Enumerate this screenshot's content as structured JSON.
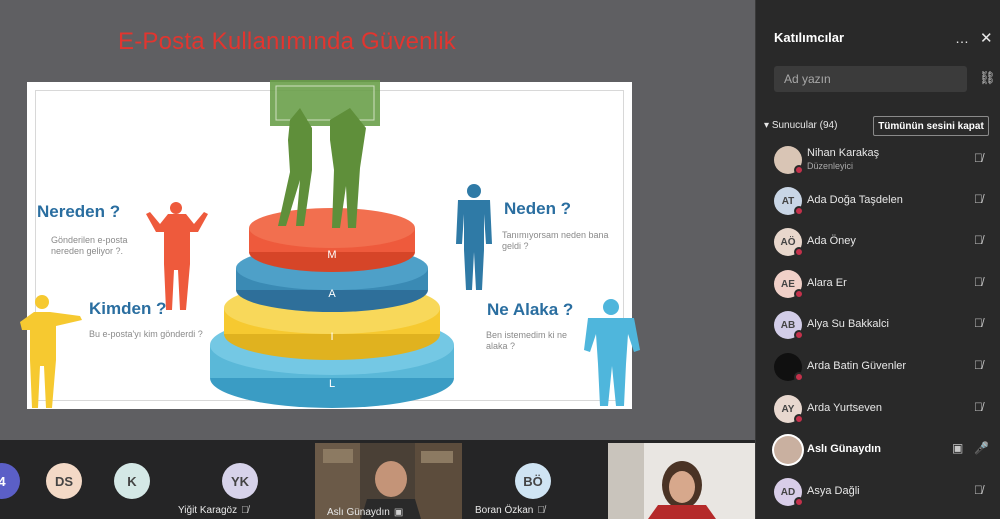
{
  "slide": {
    "title": "E-Posta Kullanımında Güvenlik",
    "q1": "Nereden ?",
    "q1_sub": "Gönderilen e-posta nereden geliyor ?.",
    "q2": "Kimden ?",
    "q2_sub": "Bu e-posta'yı kim gönderdi ?",
    "q3": "Neden ?",
    "q3_sub": "Tanımıyorsam neden bana geldi ?",
    "q4": "Ne Alaka ?",
    "q4_sub": "Ben istemedim ki ne alaka ?",
    "layers": [
      "M",
      "A",
      "I",
      "L"
    ],
    "colors": {
      "title": "#e2352f",
      "question": "#2a6ea0",
      "red": "#ee5a3c",
      "blue": "#3a8ab4",
      "yellow": "#f6c930",
      "cyan": "#5ab8d8",
      "green": "#5f8f3a",
      "orange": "#ea5a2b"
    }
  },
  "strip": {
    "tiles": [
      {
        "initials": "4"
      },
      {
        "initials": "DS"
      },
      {
        "initials": "K"
      },
      {
        "initials": "YK",
        "name": "Yiğit Karagöz"
      },
      {
        "name": "Aslı Günaydın"
      },
      {
        "initials": "BÖ",
        "name": "Boran Özkan"
      }
    ]
  },
  "panel": {
    "title": "Katılımcılar",
    "more_icon": "…",
    "close_icon": "✕",
    "search_placeholder": "Ad yazın",
    "section_label": "Sunucular (94)",
    "mute_all_label": "Tümünün sesini kapat",
    "participants": [
      {
        "initials": "",
        "name": "Nihan Karakaş",
        "role": "Düzenleyici",
        "avatar_color": "#d9c5b5"
      },
      {
        "initials": "AT",
        "name": "Ada Doğa Taşdelen",
        "avatar_color": "#c9d6e6"
      },
      {
        "initials": "AÖ",
        "name": "Ada Öney",
        "avatar_color": "#e8d7cc"
      },
      {
        "initials": "AE",
        "name": "Alara Er",
        "avatar_color": "#f0d0c8"
      },
      {
        "initials": "AB",
        "name": "Alya Su Bakkalci",
        "avatar_color": "#d2cde8"
      },
      {
        "initials": "",
        "name": "Arda Batin Güvenler",
        "avatar_color": "#101010"
      },
      {
        "initials": "AY",
        "name": "Arda Yurtseven",
        "avatar_color": "#e8d8cf"
      },
      {
        "initials": "",
        "name": "Aslı Günaydın",
        "avatar_color": "#c9b0a0"
      },
      {
        "initials": "AD",
        "name": "Asya Dağli",
        "avatar_color": "#d8cde8"
      }
    ]
  }
}
